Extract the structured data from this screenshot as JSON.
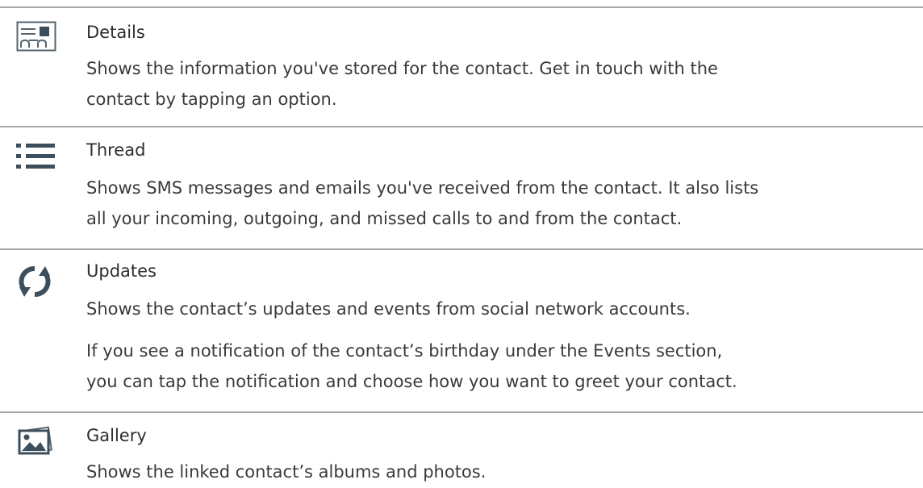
{
  "items": [
    {
      "title": "Details",
      "icon": "contact-card-icon",
      "paragraphs": [
        [
          "Shows the information you've stored for the contact. Get in touch with the",
          "contact by tapping an option."
        ]
      ]
    },
    {
      "title": "Thread",
      "icon": "list-icon",
      "paragraphs": [
        [
          "Shows SMS messages and emails you've received from the contact. It also lists",
          "all your incoming, outgoing, and missed calls to and from the contact."
        ]
      ]
    },
    {
      "title": "Updates",
      "icon": "refresh-icon",
      "paragraphs": [
        [
          "Shows the contact’s updates and events from social network accounts."
        ],
        [
          "If you see a notification of the contact’s birthday under the Events section,",
          "you can tap the notification and choose how you want to greet your contact."
        ]
      ]
    },
    {
      "title": "Gallery",
      "icon": "gallery-icon",
      "paragraphs": [
        [
          "Shows the linked contact’s albums and photos."
        ]
      ]
    }
  ],
  "colors": {
    "text": "#3a3a3a",
    "divider": "#a8a8a8",
    "icon": "#3d4f5c"
  }
}
